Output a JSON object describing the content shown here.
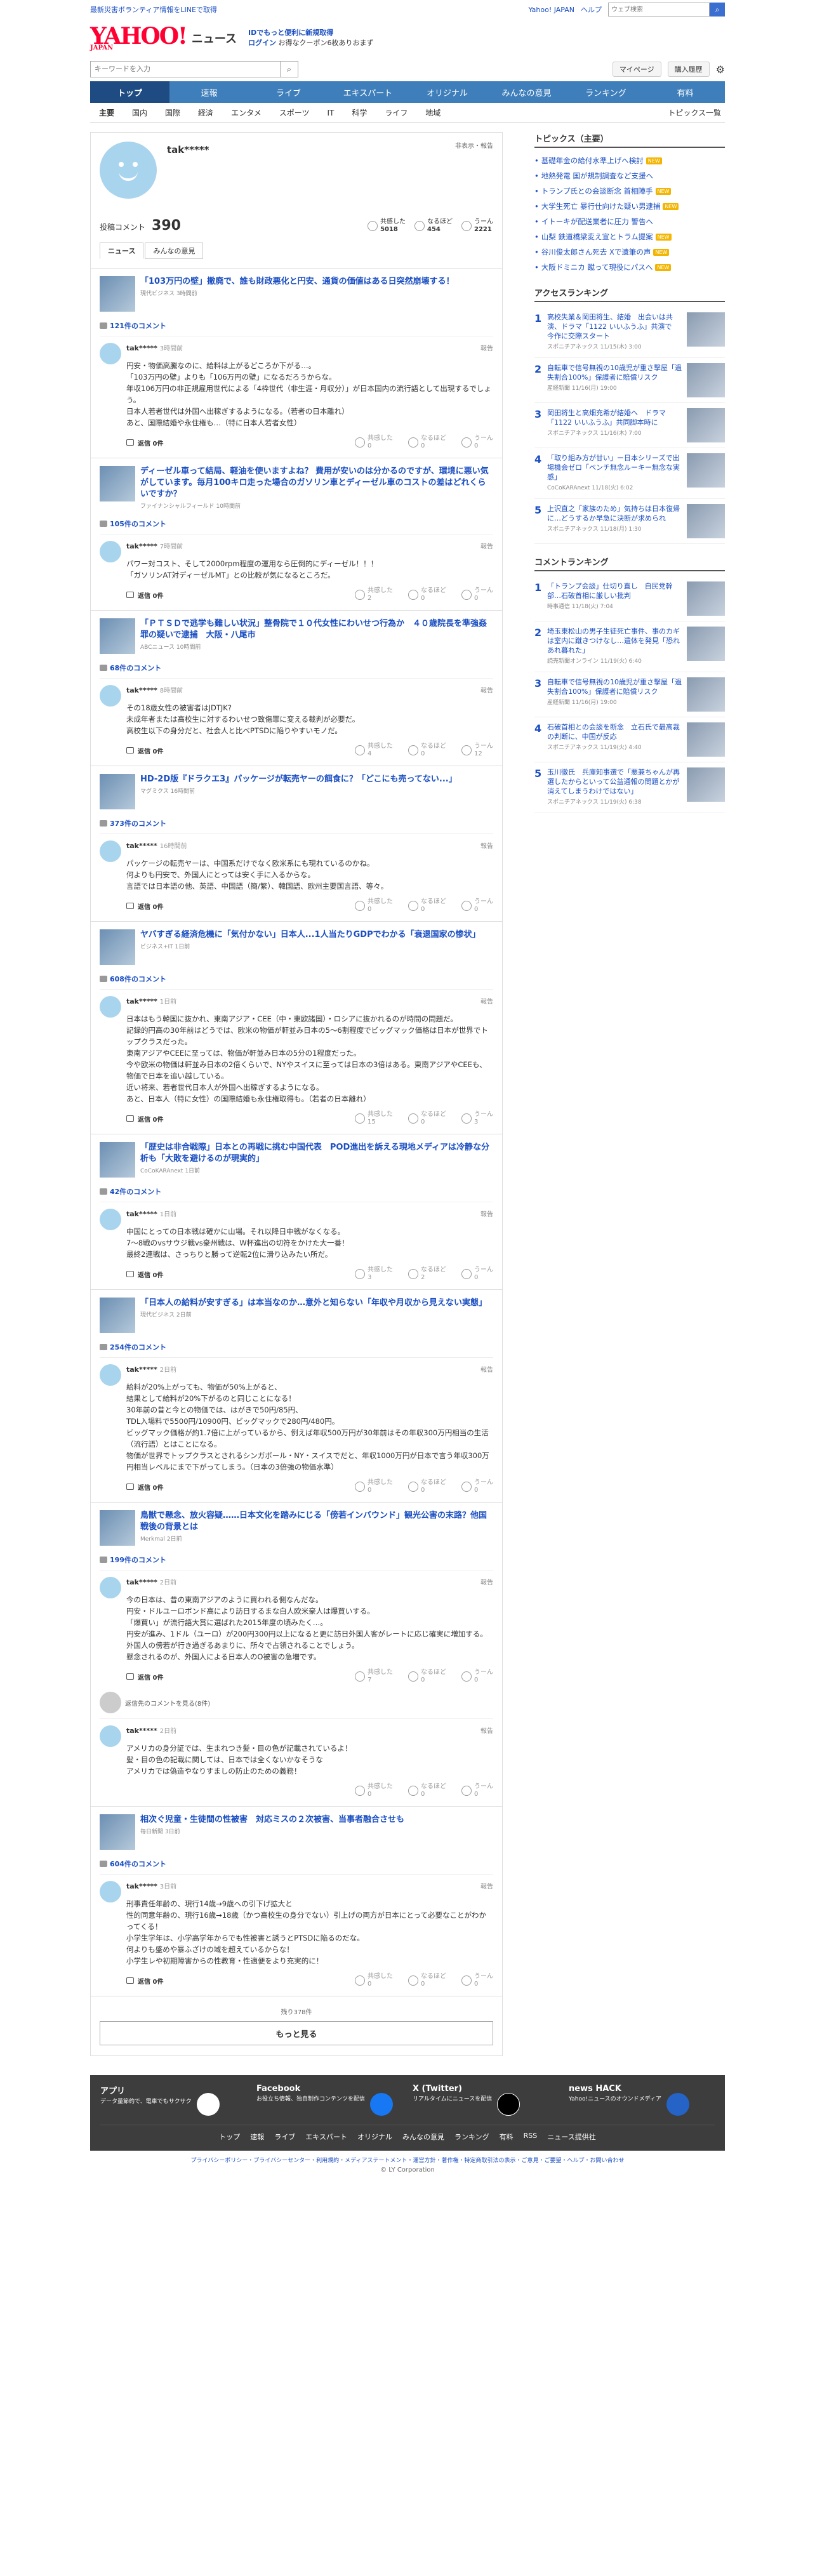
{
  "top": {
    "promo": "最新災害ボランティア情報をLINEで取得",
    "links": [
      "Yahoo! JAPAN",
      "ヘルプ"
    ],
    "search_placeholder": "ウェブ検索"
  },
  "header": {
    "logo": "YAHOO!",
    "logo_sub": "JAPAN",
    "service": "ニュース",
    "promo1": "IDでもっと便利に新規取得",
    "promo2": "ログイン",
    "promo3": "お得なクーポン6枚ありおまず"
  },
  "tools": {
    "search_placeholder": "キーワードを入力",
    "mypage": "マイページ",
    "purchase": "購入履歴"
  },
  "nav": [
    "トップ",
    "速報",
    "ライブ",
    "エキスパート",
    "オリジナル",
    "みんなの意見",
    "ランキング",
    "有料"
  ],
  "subnav": [
    "主要",
    "国内",
    "国際",
    "経済",
    "エンタメ",
    "スポーツ",
    "IT",
    "科学",
    "ライフ",
    "地域"
  ],
  "subnav_last": "トピックス一覧",
  "profile": {
    "name": "tak*****",
    "report": "非表示・報告",
    "count_label": "投稿コメント",
    "count": "390",
    "reacts": [
      {
        "label": "共感した",
        "value": "5018"
      },
      {
        "label": "なるほど",
        "value": "454"
      },
      {
        "label": "うーん",
        "value": "2221"
      }
    ],
    "tabs": [
      "ニュース",
      "みんなの意見"
    ]
  },
  "cards": [
    {
      "title": "「103万円の壁」撤廃で、誰も財政悪化と円安、通貨の価値はある日突然崩壊する！",
      "source": "現代ビジネス 3時間前",
      "count": "121件のコメント",
      "user": "tak*****",
      "date": "3時間前",
      "text": "円安・物価高騰なのに、給料は上がるどころか下がる…。\n「103万円の壁」よりも「106万円の壁」になるだろうからな。\n年収106万円の非正規雇用世代による「4枠世代（非生涯・月収分）」が日本国内の流行語として出現するでしょう。\n日本人若者世代は外国へ出稼ぎするようになる。（若者の日本離れ）\nあと、国際結婚や永住権も…（特に日本人若者女性）",
      "reply": "返信 0件",
      "votes": [
        "共感した",
        "なるほど",
        "うーん"
      ],
      "vcount": [
        "0",
        "0",
        "0"
      ]
    },
    {
      "title": "ディーゼル車って結局、軽油を使いますよね？ 費用が安いのは分かるのですが、環境に悪い気がしています。毎月100キロ走った場合のガソリン車とディーゼル車のコストの差はどれくらいですか？",
      "source": "ファイナンシャルフィールド 10時間前",
      "count": "105件のコメント",
      "user": "tak*****",
      "date": "7時間前",
      "text": "パワー対コスト、そして2000rpm程度の運用なら圧倒的にディーゼル！！！\n「ガソリンAT対ディーゼルMT」との比較が気になるところだ。",
      "reply": "返信 0件",
      "votes": [
        "共感した",
        "なるほど",
        "うーん"
      ],
      "vcount": [
        "2",
        "0",
        "0"
      ]
    },
    {
      "title": "「ＰＴＳＤで逃学も難しい状況」整骨院で１０代女性にわいせつ行為か　４０歳院長を準強姦罪の疑いで逮捕　大阪・八尾市",
      "source": "ABCニュース 10時間前",
      "count": "68件のコメント",
      "user": "tak*****",
      "date": "8時間前",
      "text": "その18歳女性の被害者はJDTJK?\n未成年者または高校生に対するわいせつ致傷罪に変える裁判が必要だ。\n高校生以下の身分だと、社会人と比べPTSDに陥りやすいモノだ。",
      "reply": "返信 0件",
      "votes": [
        "共感した",
        "なるほど",
        "うーん"
      ],
      "vcount": [
        "4",
        "0",
        "12"
      ]
    },
    {
      "title": "HD-2D版『ドラクエ3』パッケージが転売ヤーの餌食に？「どこにも売ってない...」",
      "source": "マグミクス 16時間前",
      "count": "373件のコメント",
      "user": "tak*****",
      "date": "16時間前",
      "text": "パッケージの転売ヤーは、中国系だけでなく欧米系にも現れているのかね。\n何よりも円安で、外国人にとっては安く手に入るからな。\n言語では日本語の他、英語、中国語（簡/繁）、韓国語、欧州主要国言語、等々。",
      "reply": "返信 0件",
      "votes": [
        "共感した",
        "なるほど",
        "うーん"
      ],
      "vcount": [
        "0",
        "0",
        "0"
      ]
    },
    {
      "title": "ヤバすぎる経済危機に「気付かない」日本人...1人当たりGDPでわかる「衰退国家の惨状」",
      "source": "ビジネス+IT 1日前",
      "count": "608件のコメント",
      "user": "tak*****",
      "date": "1日前",
      "text": "日本はもう韓国に抜かれ、東南アジア・CEE（中・東欧諸国）・ロシアに抜かれるのが時間の問題だ。\n記録的円高の30年前はどうでは、欧米の物価が軒並み日本の5〜6割程度でビッグマック価格は日本が世界でトップクラスだった。\n東南アジアやCEEに至っては、物価が軒並み日本の5分の1程度だった。\n今や欧米の物価は軒並み日本の2倍くらいで、NYやスイスに至っては日本の3倍はある。東南アジアやCEEも、物価で日本を追い越している。\n近い将来、若者世代日本人が外国へ出稼ぎするようになる。\nあと、日本人（特に女性）の国際結婚も永住権取得も。（若者の日本離れ）",
      "reply": "返信 0件",
      "votes": [
        "共感した",
        "なるほど",
        "うーん"
      ],
      "vcount": [
        "15",
        "0",
        "3"
      ]
    },
    {
      "title": "「歴史は非合戦際」日本との再戦に挑む中国代表　POD進出を訴える現地メディアは冷静な分析も「大敗を避けるのが現実的」",
      "source": "CoCoKARAnext 1日前",
      "count": "42件のコメント",
      "user": "tak*****",
      "date": "1日前",
      "text": "中国にとっての日本戦は確かに山場。それ以降日中戦がなくなる。\n7〜8戦のvsサウジ戦vs豪州戦は、W杯進出の切符をかけた大一番！\n最終2連戦は、さっちりと勝って逆転2位に滑り込みたい所だ。",
      "reply": "返信 0件",
      "votes": [
        "共感した",
        "なるほど",
        "うーん"
      ],
      "vcount": [
        "3",
        "2",
        "0"
      ]
    },
    {
      "title": "「日本人の給料が安すぎる」は本当なのか…意外と知らない「年収や月収から見えない実態」",
      "source": "現代ビジネス 2日前",
      "count": "254件のコメント",
      "user": "tak*****",
      "date": "2日前",
      "text": "給料が20%上がっても、物価が50%上がると、\n結果として給料が20%下がるのと同じことになる！\n30年前の昔と今との物価では、はがきで50円/85円、\nTDL入場料で5500円/10900円、ビッグマックで280円/480円。\nビッグマック価格が約1.7倍に上がっているから、例えば年収500万円が30年前はその年収300万円相当の生活（流行語）とはことになる。\n物価が世界でトップクラスとされるシンガポール・NY・スイスでだと、年収1000万円が日本で言う年収300万円相当レベルにまで下がってしまう。（日本の3倍強の物価水準）",
      "reply": "返信 0件",
      "votes": [
        "共感した",
        "なるほど",
        "うーん"
      ],
      "vcount": [
        "0",
        "0",
        "0"
      ]
    },
    {
      "title": "鳥獣で懸念、放火容疑……日本文化を踏みにじる「傍若インバウンド」観光公害の末路？他国戦後の背景とは",
      "source": "Merkmal 2日前",
      "count": "199件のコメント",
      "user": "tak*****",
      "date": "2日前",
      "text": "今の日本は、昔の東南アジアのように買われる側なんだな。\n円安・ドルユーロボンド高により訪日するまな白人欧米豪人は爆買いする。\n「爆買い」が流行語大賞に選ばれた2015年度の頃みたく…。\n円安が進み、1ドル（ユーロ）が200円300円以上になると更に訪日外国人客がレートに応じ確実に増加する。\n外国人の傍若が行き過ぎるあまりに、所々で占領されることでしょう。\n懸念されるのが、外国人による日本人のO被害の急増です。",
      "reply": "返信 0件",
      "votes": [
        "共感した",
        "なるほど",
        "うーん"
      ],
      "vcount": [
        "7",
        "0",
        "0"
      ],
      "more": "返信先のコメントを見る(8件)",
      "text2": "アメリカの身分証では、生まれつき髪・目の色が記載されているよ！\n髪・目の色の記載に関しては、日本では全くないかなそうな\nアメリカでは偽造やなりすましの防止のための義務！",
      "date2": "2日前",
      "vcount2": [
        "0",
        "0",
        "0"
      ]
    },
    {
      "title": "相次ぐ児童・生徒間の性被害　対応ミスの２次被害、当事者融合させも",
      "source": "毎日新聞 3日前",
      "count": "604件のコメント",
      "user": "tak*****",
      "date": "3日前",
      "text": "刑事責任年齢の、現行14歳→9歳への引下げ拡大と\n性的同意年齢の、現行16歳→18歳（かつ高校生の身分でない）引上げの両方が日本にとって必要なことがわかってくる！\n小学生学年は、小学高学年からでも性被害と誘うとPTSDに陥るのだな。\n何よりも盛めや暴ふざけの域を超えているからな！\n小学生レや初期障害からの性教育・性適便をより充実的に！",
      "reply": "返信 0件",
      "votes": [
        "共感した",
        "なるほど",
        "うーん"
      ],
      "vcount": [
        "0",
        "0",
        "0"
      ]
    }
  ],
  "more": {
    "remaining": "残り378件",
    "button": "もっと見る"
  },
  "right": {
    "topics_title": "トピックス（主要）",
    "topics": [
      "基礎年金の給付水準上げへ検討",
      "地熱発電 国が規制調査など支援へ",
      "トランプ氏との会談断念 首相陣手",
      "大学生死亡 暴行仕向けた疑い男逮捕",
      "イトーキが配送業者に圧力 警告へ",
      "山梨 鉄道橋梁変え宣とトラム提案",
      "谷川俊太郎さん死去 Xで遺筆の声",
      "大阪ドミニカ 蹴って現役にパスへ"
    ],
    "badges": [
      "NEW",
      "",
      "NEW",
      "NEW",
      "",
      "NEW",
      "NEW",
      "NEW"
    ],
    "access_title": "アクセスランキング",
    "access": [
      {
        "t": "高校失業＆岡田将生、結婚　出会いは共演、ドラマ「1122 いいふうふ」共演で　今作に交際スタート",
        "s": "スポニチアネックス 11/15(木) 3:00"
      },
      {
        "t": "自転車で信号無視の10歳児が重さ撃屋「過失割合100%」保護者に賠償リスク",
        "s": "産経新聞 11/16(月) 19:00"
      },
      {
        "t": "岡田将生と高畑充希が結婚へ　ドラマ「1122 いいふうふ」共同脚本時に",
        "s": "スポニチアネックス 11/16(木) 7:00"
      },
      {
        "t": "「取り組み方が甘い」ー日本シリーズで出場機会ゼロ「ベンチ無念ルーキー無念な実感」",
        "s": "CoCoKARAnext 11/18(火) 6:02"
      },
      {
        "t": "上沢直之「家族のため」気持ちは日本復帰に…どうするか早急に決断が求められ",
        "s": "スポニチアネックス 11/18(月) 1:30"
      }
    ],
    "comment_title": "コメントランキング",
    "comments": [
      {
        "t": "「トランプ会談」仕切り直し　自民党幹部…石破首相に厳しい批判",
        "s": "時事通信 11/18(火) 7:04"
      },
      {
        "t": "埼玉東松山の男子生徒死亡事件、事のカギは室内に蹴きつけなし…遺体を発見「恐れあれ暮れた」",
        "s": "読売新聞オンライン 11/19(火) 6:40"
      },
      {
        "t": "自転車で信号無視の10歳児が重さ撃屋「過失割合100%」保護者に賠償リスク",
        "s": "産経新聞 11/16(月) 19:00"
      },
      {
        "t": "石破首相との会談を断念　立石氏で最高裁の判断に、中国が反応",
        "s": "スポニチアネックス 11/19(火) 4:40"
      },
      {
        "t": "玉川徹氏　兵庫知事選で「悪兼ちゃんが再選したからといって公益通報の問題とかが消えてしまうわけではない」",
        "s": "スポニチアネックス 11/19(火) 6:38"
      }
    ]
  },
  "footer": {
    "apps": [
      {
        "title": "アプリ",
        "desc": "データ量節約で、電車でもサクサク"
      },
      {
        "title": "Facebook",
        "desc": "お役立ち情報、独自制作コンテンツを配信"
      },
      {
        "title": "X (Twitter)",
        "desc": "リアルタイムにニュースを配信"
      },
      {
        "title": "news HACK",
        "desc": "Yahoo!ニュースのオウンドメディア"
      }
    ],
    "links": [
      "トップ",
      "速報",
      "ライブ",
      "エキスパート",
      "オリジナル",
      "みんなの意見",
      "ランキング",
      "有料",
      "RSS",
      "ニュース提供社"
    ],
    "legal": "プライバシーポリシー・プライバシーセンター・利用規約・メディアステートメント・運営方針・著作権・特定商取引法の表示・ご意見・ご要望・ヘルプ・お問い合わせ",
    "copy": "© LY Corporation"
  }
}
